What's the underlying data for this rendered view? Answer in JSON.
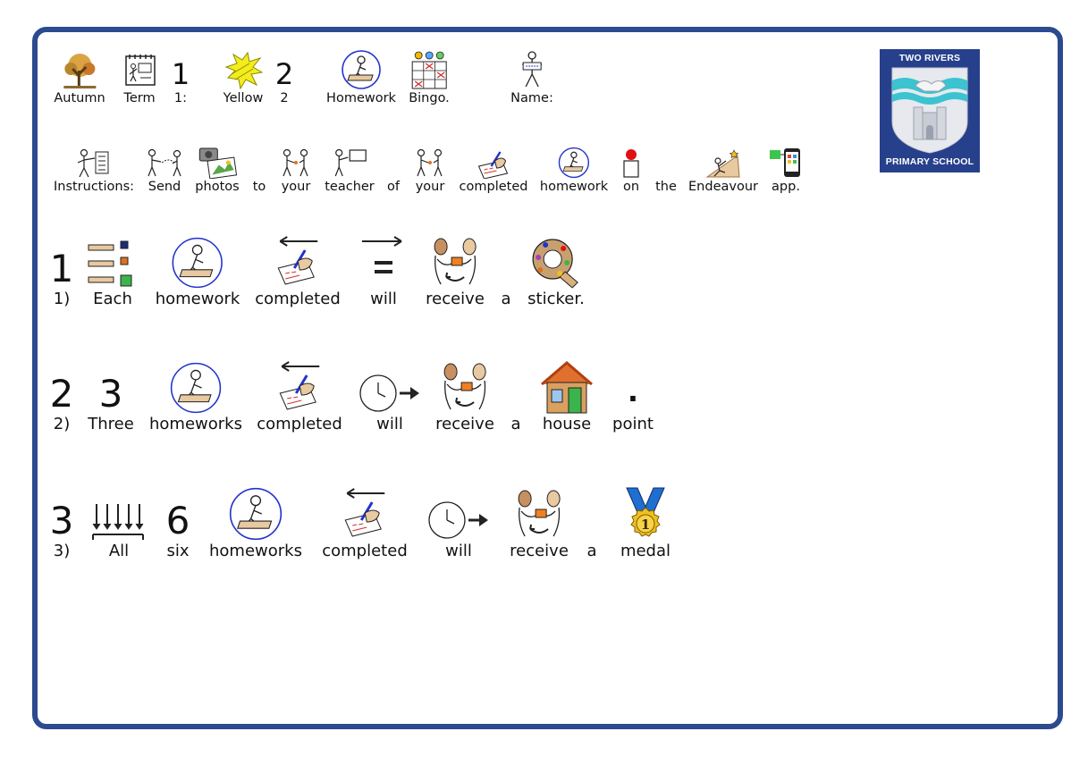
{
  "header": {
    "words": [
      "Autumn",
      "Term",
      "1:",
      "Yellow",
      "2",
      "Homework",
      "Bingo.",
      "Name:"
    ],
    "glyph_1": "1",
    "glyph_2": "2"
  },
  "instructions": {
    "words": [
      "Instructions:",
      "Send",
      "photos",
      "to",
      "your",
      "teacher",
      "of",
      "your",
      "completed",
      "homework",
      "on",
      "the",
      "Endeavour",
      "app."
    ]
  },
  "rule1": {
    "glyph": "1",
    "words": [
      "1)",
      "Each",
      "homework",
      "completed",
      "will",
      "receive",
      "a",
      "sticker."
    ]
  },
  "rule2": {
    "glyph_a": "2",
    "glyph_b": "3",
    "dot": "·",
    "words": [
      "2)",
      "Three",
      "homeworks",
      "completed",
      "will",
      "receive",
      "a",
      "house",
      "point"
    ]
  },
  "rule3": {
    "glyph_a": "3",
    "glyph_b": "6",
    "words": [
      "3)",
      "All",
      "six",
      "homeworks",
      "completed",
      "will",
      "receive",
      "a",
      "medal"
    ]
  },
  "logo": {
    "top_text": "TWO RIVERS",
    "bottom_text": "PRIMARY SCHOOL",
    "colors": {
      "background": "#27408b",
      "water": "#3bc3d0",
      "shield": "#e7e9ef"
    }
  },
  "colors": {
    "border": "#2b4a8f",
    "circle": "#2233cc"
  }
}
